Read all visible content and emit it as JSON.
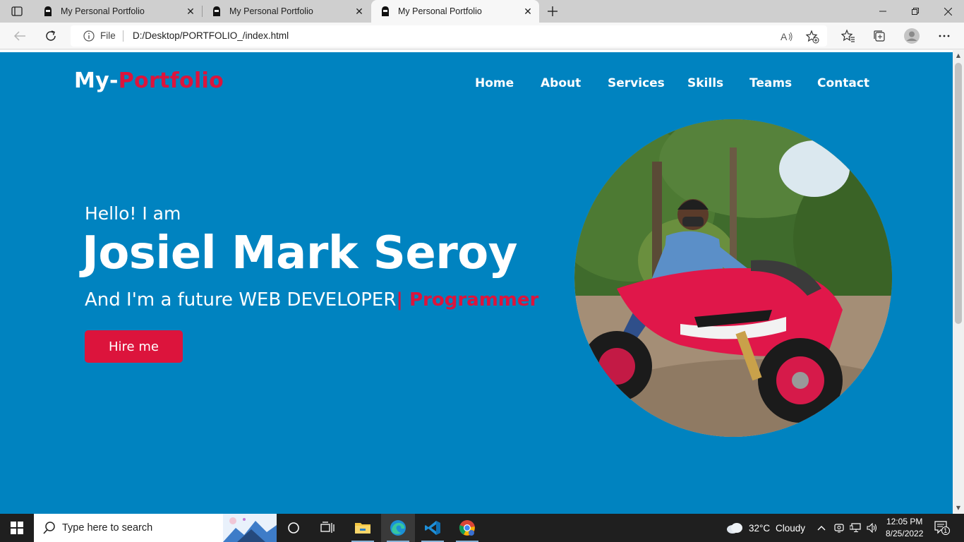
{
  "browser": {
    "tabs": [
      {
        "title": "My Personal Portfolio",
        "active": false
      },
      {
        "title": "My Personal Portfolio",
        "active": false
      },
      {
        "title": "My Personal Portfolio",
        "active": true
      }
    ],
    "address": {
      "scheme_label": "File",
      "url": "D:/Desktop/PORTFOLIO_/index.html"
    }
  },
  "site": {
    "logo": {
      "main": "My-",
      "accent": "Portfolio"
    },
    "nav": [
      "Home",
      "About",
      "Services",
      "Skills",
      "Teams",
      "Contact"
    ],
    "hero": {
      "greeting": "Hello! I am",
      "name": "Josiel Mark Seroy",
      "tagline": "And I'm a future WEB DEVELOPER",
      "typed_text": "| Programmer",
      "cta": "Hire me"
    },
    "colors": {
      "background": "#0083c0",
      "accent": "#dc143c",
      "text": "#ffffff"
    }
  },
  "taskbar": {
    "search_placeholder": "Type here to search",
    "weather": {
      "temp": "32°C",
      "condition": "Cloudy"
    },
    "time": "12:05 PM",
    "date": "8/25/2022",
    "notification_count": "1",
    "pinned_apps": [
      "task-view",
      "file-explorer",
      "edge",
      "vscode",
      "chrome"
    ]
  }
}
